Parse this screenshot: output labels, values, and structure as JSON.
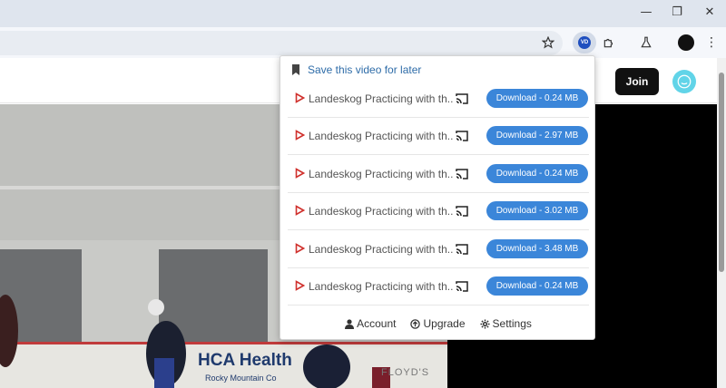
{
  "window": {
    "minimize_glyph": "—",
    "maximize_glyph": "❐",
    "close_glyph": "✕"
  },
  "toolbar": {
    "star_icon": "star-icon",
    "extension_badge": "VD",
    "menu_glyph": "⋮"
  },
  "page": {
    "join_label": "Join"
  },
  "popup": {
    "save_label": "Save this video for later",
    "items": [
      {
        "title": "Landeskog Practicing with th...",
        "download": "Download - 0.24 MB"
      },
      {
        "title": "Landeskog Practicing with th...",
        "download": "Download - 2.97 MB"
      },
      {
        "title": "Landeskog Practicing with th...",
        "download": "Download - 0.24 MB"
      },
      {
        "title": "Landeskog Practicing with th...",
        "download": "Download - 3.02 MB"
      },
      {
        "title": "Landeskog Practicing with th...",
        "download": "Download - 3.48 MB"
      },
      {
        "title": "Landeskog Practicing with th...",
        "download": "Download - 0.24 MB"
      }
    ],
    "footer": {
      "account": "Account",
      "upgrade": "Upgrade",
      "settings": "Settings"
    }
  },
  "video": {
    "banner_text": "HCA Health",
    "banner_sub": "Rocky Mountain Co",
    "banner_right": "FLOYD'S"
  },
  "colors": {
    "accent_blue": "#3b86d9",
    "link_blue": "#2e6ca8",
    "play_red": "#d0312d"
  }
}
